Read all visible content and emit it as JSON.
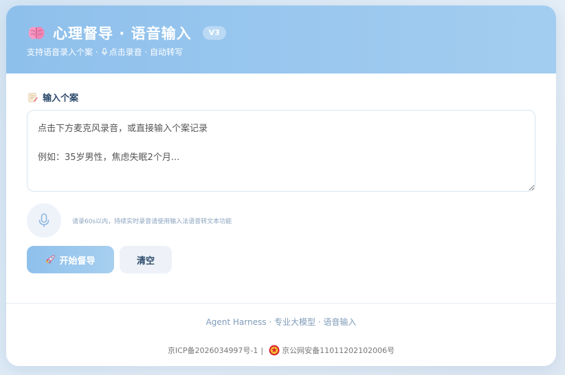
{
  "header": {
    "title": "心理督导 · 语音输入",
    "version": "V3",
    "subtitle_part1": "支持语音录入个案 · ",
    "subtitle_part2": "点击录音 · 自动转写"
  },
  "input_section": {
    "label": "输入个案",
    "placeholder": "点击下方麦克风录音，或直接输入个案记录\n\n例如：35岁男性，焦虑失眠2个月..."
  },
  "recorder": {
    "hint": "请录60s以内，持续实时录音请使用输入法语音转文本功能"
  },
  "actions": {
    "start_label": "开始督导",
    "clear_label": "清空"
  },
  "footer": {
    "tagline": "Agent Harness · 专业大模型 · 语音输入",
    "icp": "京ICP备2026034997号-1",
    "separator": "|",
    "police": "京公网安备11011202102006号"
  },
  "colors": {
    "accent": "#8ec0ec",
    "accent_light": "#a3cdf0",
    "title_text": "#2c4a6b",
    "hint_text": "#8aa3bf"
  },
  "icons": {
    "title": "brain-icon",
    "subtitle": "microphone-icon",
    "section": "memo-icon",
    "recorder": "microphone-icon",
    "start": "rocket-icon",
    "footer": "police-emblem-icon"
  }
}
